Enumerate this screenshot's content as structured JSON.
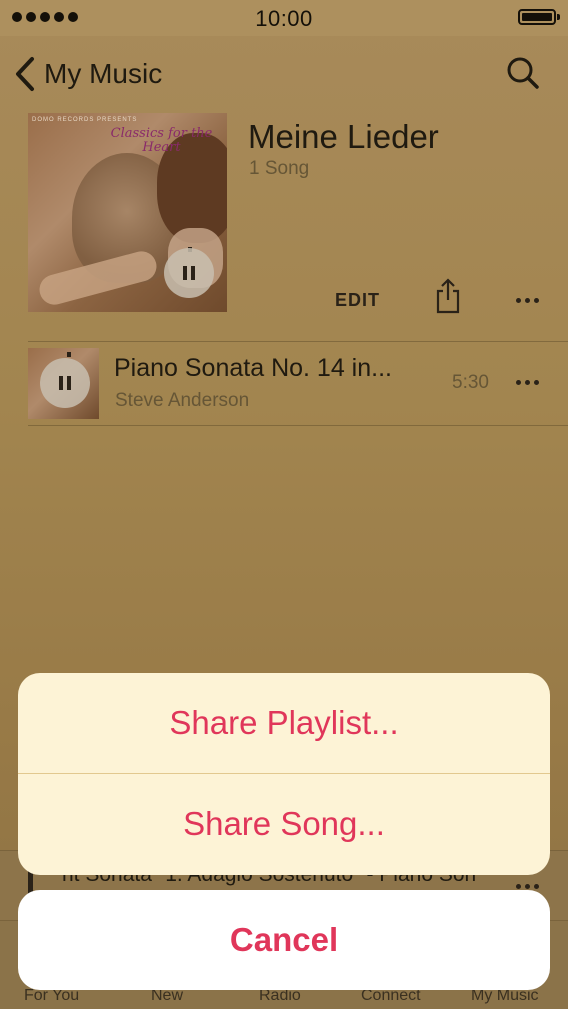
{
  "status": {
    "time": "10:00"
  },
  "nav": {
    "back_label": "My Music"
  },
  "playlist": {
    "title": "Meine Lieder",
    "count": "1 Song",
    "edit_label": "EDIT",
    "cover_brand": "DOMO RECORDS PRESENTS",
    "cover_title": "Classics for the Heart"
  },
  "song": {
    "title": "Piano Sonata No. 14 in...",
    "artist": "Steve Anderson",
    "duration": "5:30"
  },
  "mini_player": {
    "text": "nt Sonata \"1. Adagio Sostenuto\" - Piano Son"
  },
  "tabs": [
    {
      "label": "For You"
    },
    {
      "label": "New"
    },
    {
      "label": "Radio"
    },
    {
      "label": "Connect"
    },
    {
      "label": "My Music"
    }
  ],
  "action_sheet": {
    "share_playlist": "Share Playlist...",
    "share_song": "Share Song...",
    "cancel": "Cancel"
  },
  "colors": {
    "accent": "#e0365a",
    "sheet_bg": "#fdf3d6"
  }
}
